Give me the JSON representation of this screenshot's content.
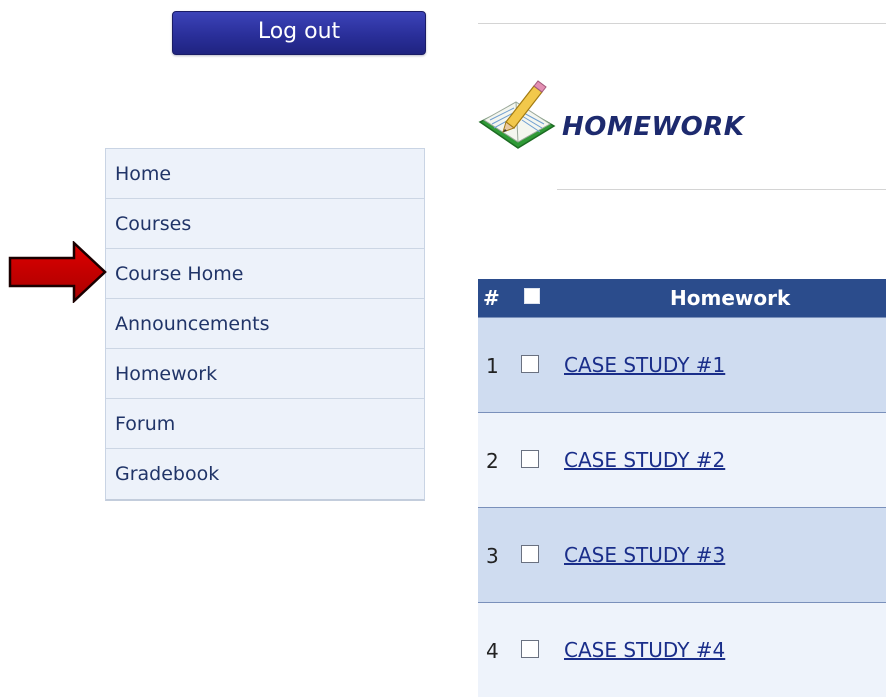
{
  "header": {
    "logout_label": "Log out"
  },
  "page": {
    "title": "HOMEWORK"
  },
  "sidebar": {
    "items": [
      {
        "label": "Home"
      },
      {
        "label": "Courses"
      },
      {
        "label": "Course Home"
      },
      {
        "label": "Announcements"
      },
      {
        "label": "Homework"
      },
      {
        "label": "Forum"
      },
      {
        "label": "Gradebook"
      }
    ]
  },
  "pointer": {
    "target": "Course Home",
    "color": "#c00000",
    "icon": "red-arrow-icon"
  },
  "table": {
    "header": {
      "num": "#",
      "label": "Homework"
    },
    "rows": [
      {
        "num": "1",
        "title": "CASE STUDY #1"
      },
      {
        "num": "2",
        "title": "CASE STUDY #2"
      },
      {
        "num": "3",
        "title": "CASE STUDY #3"
      },
      {
        "num": "4",
        "title": "CASE STUDY #4"
      }
    ]
  },
  "colors": {
    "button": "#2a2f9a",
    "table_header": "#2b4c8c",
    "row_odd": "#cfdcf0",
    "row_even": "#eef3fb",
    "title": "#1d2a6e"
  }
}
